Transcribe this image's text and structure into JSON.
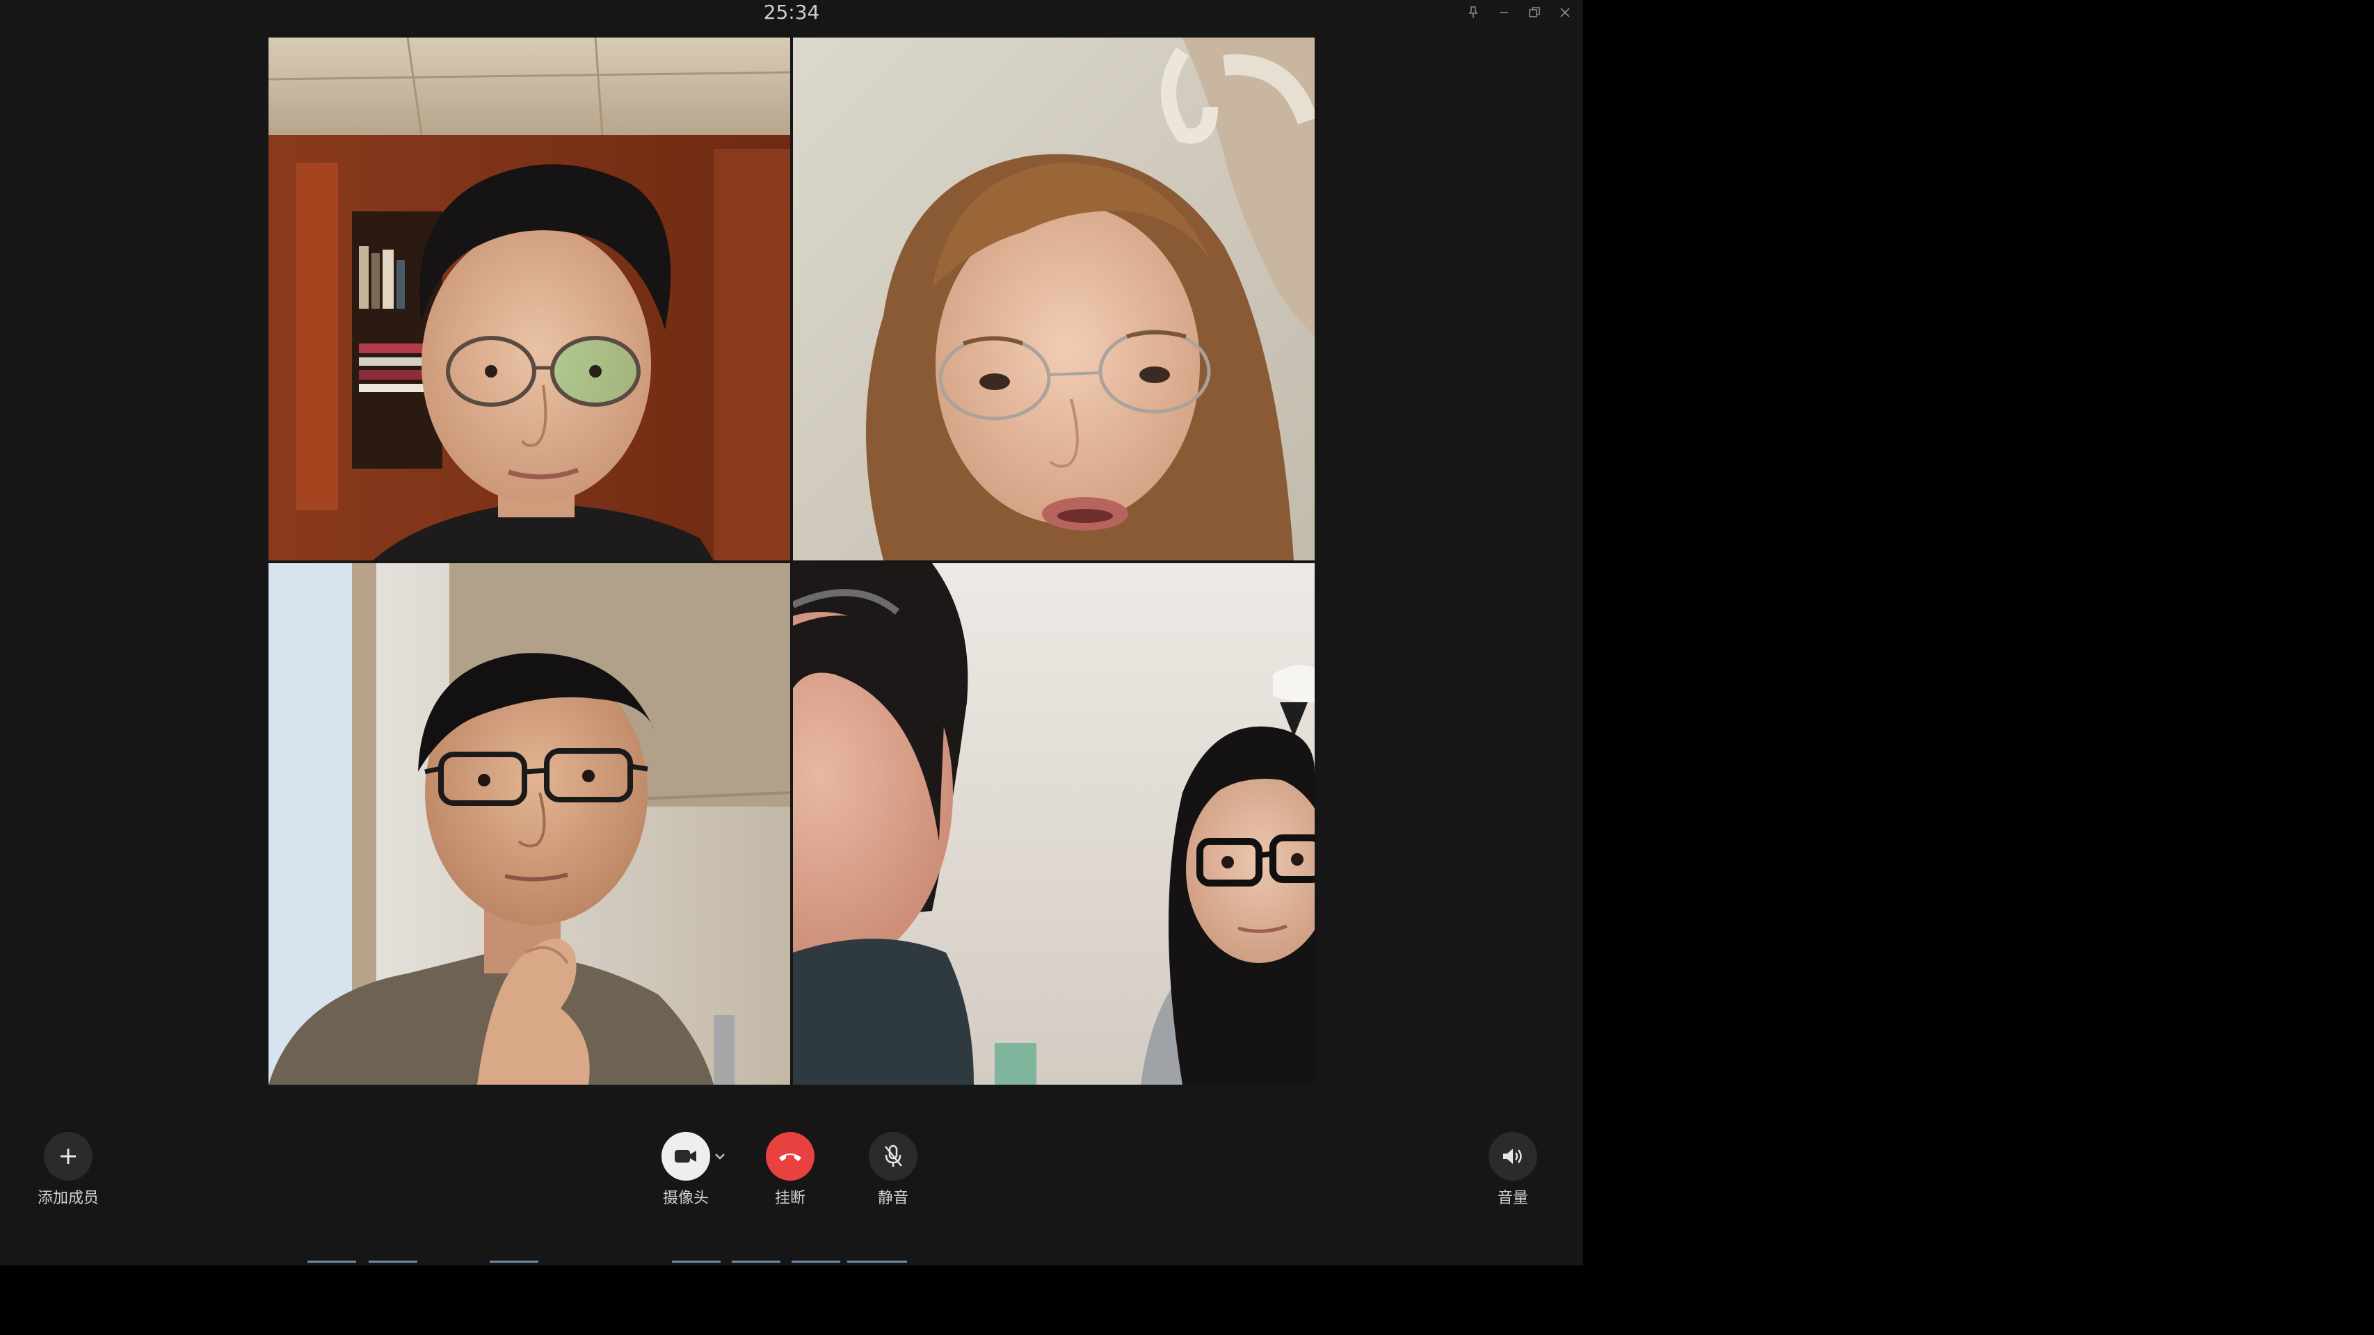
{
  "window": {
    "timer": "25:34",
    "controls": [
      {
        "icon": "pin-icon"
      },
      {
        "icon": "minimize-icon"
      },
      {
        "icon": "restore-icon"
      },
      {
        "icon": "close-icon"
      }
    ]
  },
  "participants": [
    {
      "icon": "participant-video-1"
    },
    {
      "icon": "participant-video-2"
    },
    {
      "icon": "participant-video-3"
    },
    {
      "icon": "participant-video-4"
    }
  ],
  "toolbar": {
    "add_member_label": "添加成员",
    "camera_label": "摄像头",
    "hangup_label": "挂断",
    "mute_label": "静音",
    "volume_label": "音量"
  },
  "colors": {
    "window_bg": "#161616",
    "hangup": "#e8413f",
    "camera_button": "#eeeeee",
    "button_bg": "#2b2b2b"
  }
}
